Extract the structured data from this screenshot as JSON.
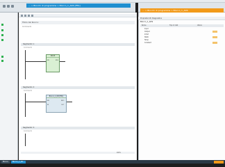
{
  "window": {
    "breadcrumb_left": "... > Blocchi di programma > Blocco_1_ADS [FB1]",
    "breadcrumb_right": "... > Blocchi di programma > Blocco_1_ADS"
  },
  "editor": {
    "block_title": "Titolo del blocco:",
    "block_comment": "Commento",
    "segments": [
      {
        "header": "Segmento 1:",
        "comment": "Commento"
      },
      {
        "header": "Segmento 2:",
        "comment": "Commento"
      },
      {
        "header": "Segmento 3:",
        "comment": "Commento"
      }
    ],
    "fb1": {
      "title": "%DB",
      "type": "MOVE",
      "in": "EN",
      "out": "ENO"
    },
    "fb2": {
      "title": "Blocco_1_DB [FB1]",
      "in1": "EN",
      "in2": "IN",
      "out1": "ENO",
      "out2": "OUT"
    },
    "zoom": "100%"
  },
  "interface": {
    "tabs": "Proprietà  Info  Diagnostica",
    "title": "Blocco_1_ADS",
    "columns": [
      "Nome",
      "Tipo di dati",
      "Valore"
    ],
    "rows": [
      {
        "name": "Input",
        "type": "",
        "value": ""
      },
      {
        "name": "Output",
        "type": "",
        "value": ""
      },
      {
        "name": "InOut",
        "type": "",
        "value": ""
      },
      {
        "name": "Static",
        "type": "",
        "value": ""
      },
      {
        "name": "Temp",
        "type": "",
        "value": ""
      },
      {
        "name": "Constant",
        "type": "",
        "value": ""
      }
    ]
  },
  "taskbar": {
    "items": [
      "Blocco",
      "Blocco_1_AD..."
    ],
    "right": ""
  },
  "tree": {
    "items": [
      "",
      "",
      "",
      "",
      "",
      ""
    ]
  },
  "colors": {
    "accent_blue": "#1f8fd0",
    "accent_orange": "#f29a1a",
    "tree_green": "#2eb04f"
  }
}
